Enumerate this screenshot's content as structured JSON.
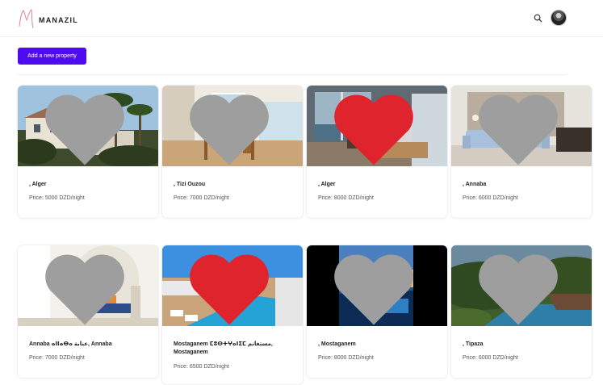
{
  "brand": {
    "name": "MANAZIL"
  },
  "header": {
    "search_icon": "search-icon",
    "avatar_icon": "user-avatar"
  },
  "actions": {
    "add_property": "Add a new property"
  },
  "colors": {
    "accent": "#4f0bf0",
    "heart_active": "#e0242d",
    "heart_inactive": "#9e9e9e"
  },
  "properties": [
    {
      "title": ", Alger",
      "price": "Price: 5000 DZD/night",
      "favorite": false
    },
    {
      "title": ", Tizi Ouzou",
      "price": "Price: 7000 DZD/night",
      "favorite": false
    },
    {
      "title": ", Alger",
      "price": "Price: 8000 DZD/night",
      "favorite": true
    },
    {
      "title": ", Annaba",
      "price": "Price: 6000 DZD/night",
      "favorite": false
    },
    {
      "title": "Annaba ⴰⵏⵏⴰⴱⴰ عنابة, Annaba",
      "price": "Price: 7000 DZD/night",
      "favorite": false
    },
    {
      "title": "Mostaganem ⵎⵓⵙⵜⵖⴰⵏⵉⵎ مستغانم, Mostaganem",
      "price": "Price: 6500 DZD/night",
      "favorite": true
    },
    {
      "title": ", Mostaganem",
      "price": "Price: 8000 DZD/night",
      "favorite": false
    },
    {
      "title": ", Tipaza",
      "price": "Price: 6000 DZD/night",
      "favorite": false
    }
  ]
}
